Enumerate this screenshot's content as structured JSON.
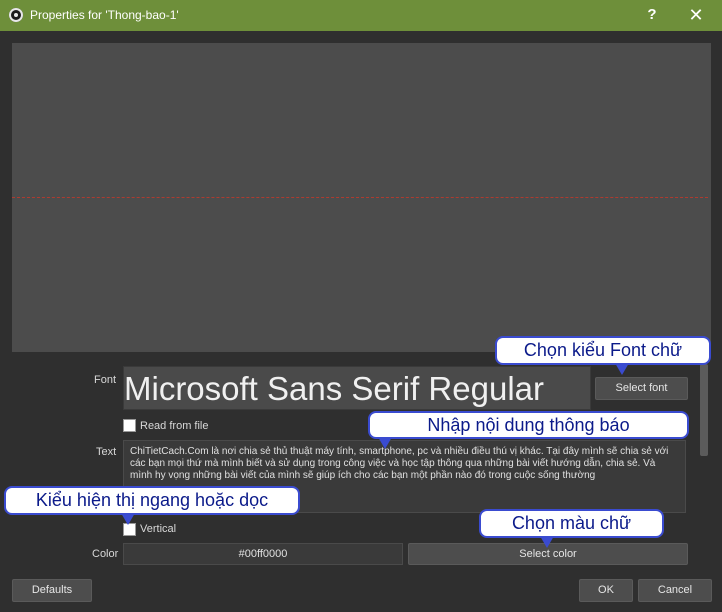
{
  "window": {
    "title": "Properties for 'Thong-bao-1'",
    "help_glyph": "?",
    "close_glyph": "✕"
  },
  "form": {
    "font_label": "Font",
    "font_value": "Microsoft Sans Serif Regular",
    "select_font_label": "Select font",
    "read_from_file_label": "Read from file",
    "read_from_file_checked": false,
    "text_label": "Text",
    "text_value": "ChiTietCach.Com là nơi chia sẻ thủ thuật máy tính, smartphone, pc và nhiều điều thú vị khác. Tại đây mình sẽ chia sẻ với các bạn mọi thứ mà mình biết và sử dụng trong công việc và học tập thông qua những bài viết hướng dẫn, chia sẻ. Và mình hy vọng những bài viết của mình sẽ giúp ích cho các bạn một phần nào đó trong cuộc sống thường",
    "vertical_label": "Vertical",
    "vertical_checked": false,
    "color_label": "Color",
    "color_value": "#00ff0000",
    "select_color_label": "Select color"
  },
  "footer": {
    "defaults_label": "Defaults",
    "ok_label": "OK",
    "cancel_label": "Cancel"
  },
  "annotations": {
    "font_callout": "Chọn kiểu Font chữ",
    "text_callout": "Nhập nội dung thông báo",
    "vertical_callout": "Kiểu hiện thị ngang hoặc dọc",
    "color_callout": "Chọn màu chữ"
  },
  "colors": {
    "titlebar": "#6e8f3a",
    "preview_bg": "#4c4c4c",
    "callout_border": "#3a4bd0",
    "callout_text": "#0b1a8a"
  }
}
